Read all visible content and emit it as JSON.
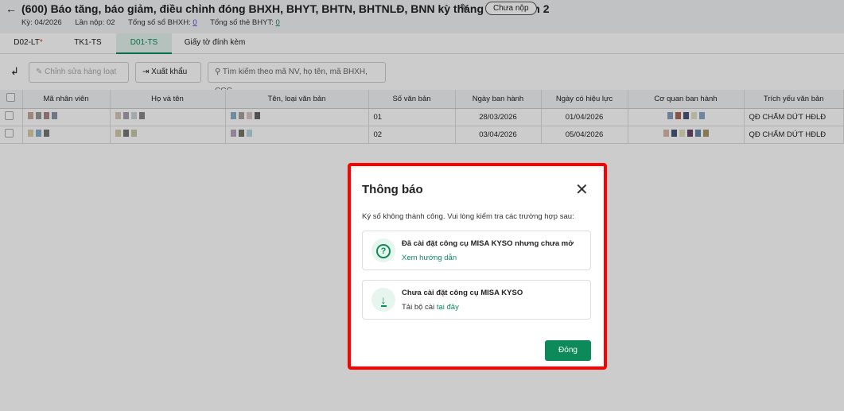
{
  "header": {
    "title": "(600) Báo tăng, báo giảm, điều chỉnh đóng BHXH, BHYT, BHTN, BHTNLĐ, BNN kỳ tháng 4/2026 lần 2",
    "status": "Chưa nộp",
    "period": "Kỳ: 04/2026",
    "submission": "Lần nộp: 02",
    "bhxh_label": "Tổng số sổ BHXH: ",
    "bhxh_count": "0",
    "bhyt_label": "Tổng số thẻ BHYT: ",
    "bhyt_count": "0"
  },
  "tabs": [
    {
      "label": "D02-LT",
      "required": "*"
    },
    {
      "label": "TK1-TS"
    },
    {
      "label": "D01-TS",
      "active": true
    },
    {
      "label": "Giấy tờ đính kèm"
    }
  ],
  "toolbar": {
    "bulk_edit": "Chỉnh sửa hàng loạt",
    "export": "Xuất khẩu",
    "search_placeholder": "Tìm kiếm theo mã NV, họ tên, mã BHXH, CCC..."
  },
  "table": {
    "columns": [
      "Mã nhân viên",
      "Họ và tên",
      "Tên, loại văn bản",
      "Số văn bản",
      "Ngày ban hành",
      "Ngày có hiệu lực",
      "Cơ quan ban hành",
      "Trích yếu văn bản"
    ],
    "rows": [
      {
        "so": "01",
        "ngay_bh": "28/03/2026",
        "ngay_hl": "01/04/2026",
        "trich_yeu": "QĐ CHẤM DỨT HĐLĐ"
      },
      {
        "so": "02",
        "ngay_bh": "03/04/2026",
        "ngay_hl": "05/04/2026",
        "trich_yeu": "QĐ CHẤM DỨT HĐLĐ"
      }
    ]
  },
  "modal": {
    "title": "Thông báo",
    "message": "Ký số không thành công. Vui lòng kiểm tra các trường hợp sau:",
    "case1": {
      "title": "Đã cài đặt công cụ MISA KYSO nhưng chưa mở",
      "link": "Xem hướng dẫn",
      "icon": "question-circle-icon"
    },
    "case2": {
      "title": "Chưa cài đặt công cụ MISA KYSO",
      "text": "Tải bộ cài ",
      "link": "tại đây",
      "icon": "download-icon"
    },
    "close_button": "Đóng"
  },
  "colors": {
    "accent": "#0d8a5a",
    "highlight_border": "#ff0000"
  }
}
